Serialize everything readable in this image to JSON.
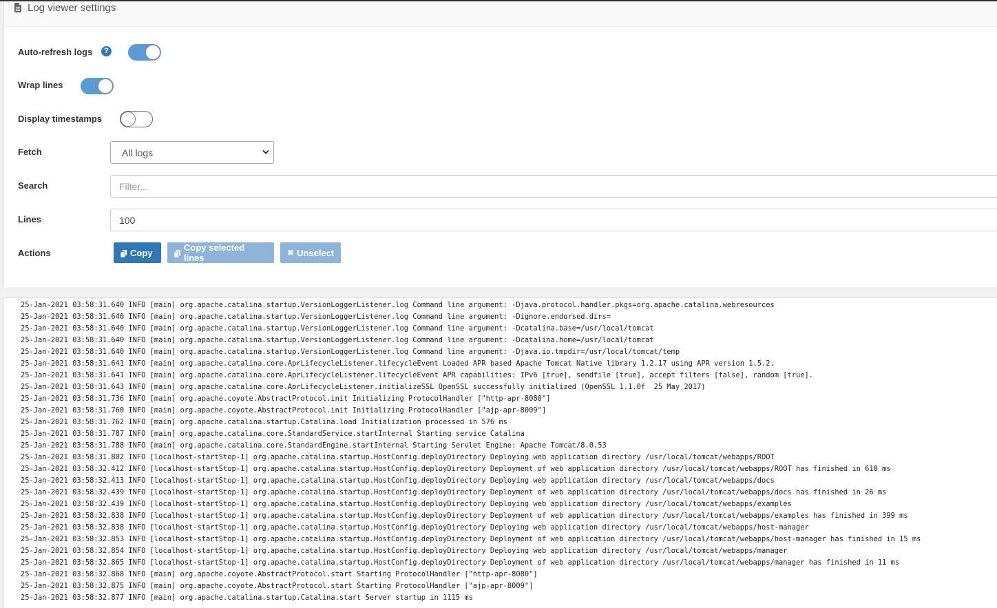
{
  "header": {
    "title": "Log viewer settings",
    "icon": "document-icon"
  },
  "settings": {
    "auto_refresh": {
      "label": "Auto-refresh logs",
      "enabled": true,
      "help": "?"
    },
    "wrap_lines": {
      "label": "Wrap lines",
      "enabled": true
    },
    "display_timestamps": {
      "label": "Display timestamps",
      "enabled": false
    },
    "fetch": {
      "label": "Fetch",
      "selected": "All logs"
    },
    "search": {
      "label": "Search",
      "placeholder": "Filter..."
    },
    "lines": {
      "label": "Lines",
      "value": "100"
    },
    "actions": {
      "label": "Actions",
      "copy": "Copy",
      "copy_selected": "Copy selected lines",
      "unselect": "Unselect"
    }
  },
  "colors": {
    "primary": "#2f77b5",
    "toggle_on": "#5b9bd5",
    "disabled": "#8eb5d9"
  },
  "log": [
    "25-Jan-2021 03:58:31.640 INFO [main] org.apache.catalina.startup.VersionLoggerListener.log Command line argument: -Djava.protocol.handler.pkgs=org.apache.catalina.webresources",
    "25-Jan-2021 03:58:31.640 INFO [main] org.apache.catalina.startup.VersionLoggerListener.log Command line argument: -Dignore.endorsed.dirs=",
    "25-Jan-2021 03:58:31.640 INFO [main] org.apache.catalina.startup.VersionLoggerListener.log Command line argument: -Dcatalina.base=/usr/local/tomcat",
    "25-Jan-2021 03:58:31.640 INFO [main] org.apache.catalina.startup.VersionLoggerListener.log Command line argument: -Dcatalina.home=/usr/local/tomcat",
    "25-Jan-2021 03:58:31.640 INFO [main] org.apache.catalina.startup.VersionLoggerListener.log Command line argument: -Djava.io.tmpdir=/usr/local/tomcat/temp",
    "25-Jan-2021 03:58:31.641 INFO [main] org.apache.catalina.core.AprLifecycleListener.lifecycleEvent Loaded APR based Apache Tomcat Native library 1.2.17 using APR version 1.5.2.",
    "25-Jan-2021 03:58:31.641 INFO [main] org.apache.catalina.core.AprLifecycleListener.lifecycleEvent APR capabilities: IPv6 [true], sendfile [true], accept filters [false], random [true].",
    "25-Jan-2021 03:58:31.643 INFO [main] org.apache.catalina.core.AprLifecycleListener.initializeSSL OpenSSL successfully initialized (OpenSSL 1.1.0f  25 May 2017)",
    "25-Jan-2021 03:58:31.736 INFO [main] org.apache.coyote.AbstractProtocol.init Initializing ProtocolHandler [\"http-apr-8080\"]",
    "25-Jan-2021 03:58:31.760 INFO [main] org.apache.coyote.AbstractProtocol.init Initializing ProtocolHandler [\"ajp-apr-8009\"]",
    "25-Jan-2021 03:58:31.762 INFO [main] org.apache.catalina.startup.Catalina.load Initialization processed in 576 ms",
    "25-Jan-2021 03:58:31.787 INFO [main] org.apache.catalina.core.StandardService.startInternal Starting service Catalina",
    "25-Jan-2021 03:58:31.788 INFO [main] org.apache.catalina.core.StandardEngine.startInternal Starting Servlet Engine: Apache Tomcat/8.0.53",
    "25-Jan-2021 03:58:31.802 INFO [localhost-startStop-1] org.apache.catalina.startup.HostConfig.deployDirectory Deploying web application directory /usr/local/tomcat/webapps/ROOT",
    "25-Jan-2021 03:58:32.412 INFO [localhost-startStop-1] org.apache.catalina.startup.HostConfig.deployDirectory Deployment of web application directory /usr/local/tomcat/webapps/ROOT has finished in 610 ms",
    "25-Jan-2021 03:58:32.413 INFO [localhost-startStop-1] org.apache.catalina.startup.HostConfig.deployDirectory Deploying web application directory /usr/local/tomcat/webapps/docs",
    "25-Jan-2021 03:58:32.439 INFO [localhost-startStop-1] org.apache.catalina.startup.HostConfig.deployDirectory Deployment of web application directory /usr/local/tomcat/webapps/docs has finished in 26 ms",
    "25-Jan-2021 03:58:32.439 INFO [localhost-startStop-1] org.apache.catalina.startup.HostConfig.deployDirectory Deploying web application directory /usr/local/tomcat/webapps/examples",
    "25-Jan-2021 03:58:32.838 INFO [localhost-startStop-1] org.apache.catalina.startup.HostConfig.deployDirectory Deployment of web application directory /usr/local/tomcat/webapps/examples has finished in 399 ms",
    "25-Jan-2021 03:58:32.838 INFO [localhost-startStop-1] org.apache.catalina.startup.HostConfig.deployDirectory Deploying web application directory /usr/local/tomcat/webapps/host-manager",
    "25-Jan-2021 03:58:32.853 INFO [localhost-startStop-1] org.apache.catalina.startup.HostConfig.deployDirectory Deployment of web application directory /usr/local/tomcat/webapps/host-manager has finished in 15 ms",
    "25-Jan-2021 03:58:32.854 INFO [localhost-startStop-1] org.apache.catalina.startup.HostConfig.deployDirectory Deploying web application directory /usr/local/tomcat/webapps/manager",
    "25-Jan-2021 03:58:32.865 INFO [localhost-startStop-1] org.apache.catalina.startup.HostConfig.deployDirectory Deployment of web application directory /usr/local/tomcat/webapps/manager has finished in 11 ms",
    "25-Jan-2021 03:58:32.868 INFO [main] org.apache.coyote.AbstractProtocol.start Starting ProtocolHandler [\"http-apr-8080\"]",
    "25-Jan-2021 03:58:32.875 INFO [main] org.apache.coyote.AbstractProtocol.start Starting ProtocolHandler [\"ajp-apr-8009\"]",
    "25-Jan-2021 03:58:32.877 INFO [main] org.apache.catalina.startup.Catalina.start Server startup in 1115 ms"
  ]
}
